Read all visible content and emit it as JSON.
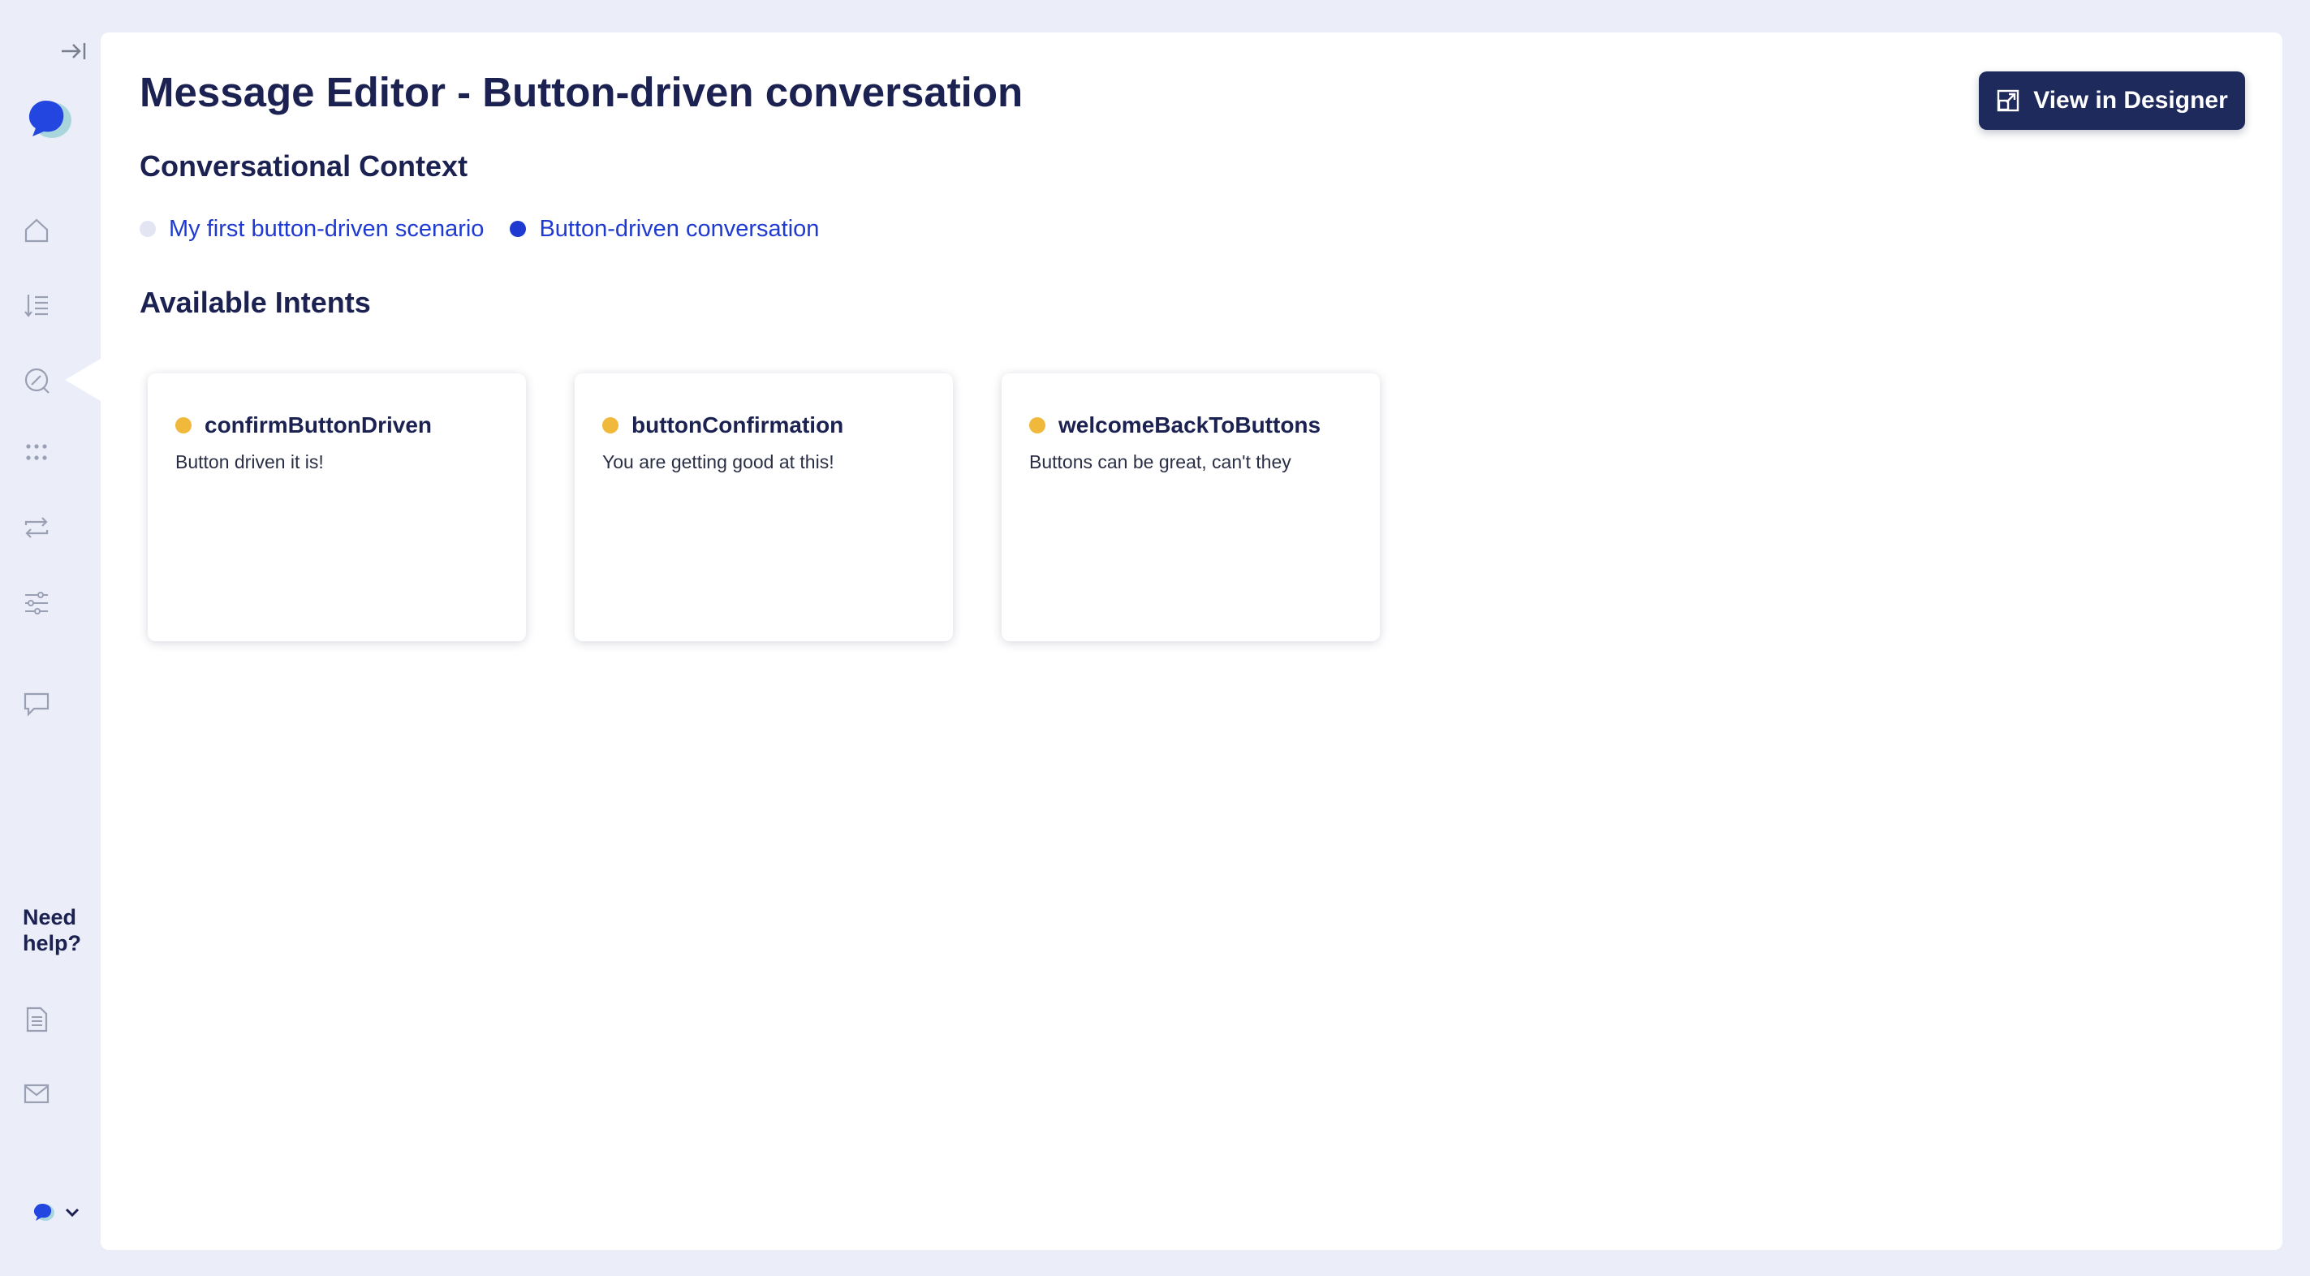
{
  "sidebar": {
    "collapse_icon": "collapse-right-icon",
    "nav_items": [
      {
        "name": "home-icon"
      },
      {
        "name": "sort-list-icon"
      },
      {
        "name": "message-editor-icon",
        "active": true
      },
      {
        "name": "grid-dots-icon"
      },
      {
        "name": "repeat-icon"
      },
      {
        "name": "sliders-icon"
      },
      {
        "name": "chat-icon"
      }
    ],
    "help_label": "Need help?",
    "help_items": [
      {
        "name": "document-icon"
      },
      {
        "name": "mail-icon"
      }
    ]
  },
  "header": {
    "title": "Message Editor - Button-driven conversation",
    "view_button_label": "View in Designer",
    "view_button_icon": "open-external-icon"
  },
  "context": {
    "heading": "Conversational Context",
    "items": [
      {
        "label": "My first button-driven scenario",
        "dot_color": "#e3e6f2"
      },
      {
        "label": "Button-driven conversation",
        "dot_color": "#1f3ad0"
      }
    ]
  },
  "intents": {
    "heading": "Available Intents",
    "items": [
      {
        "name": "confirmButtonDriven",
        "text": "Button driven it is!",
        "dot_color": "#f0b93b"
      },
      {
        "name": "buttonConfirmation",
        "text": "You are getting good at this!",
        "dot_color": "#f0b93b"
      },
      {
        "name": "welcomeBackToButtons",
        "text": "Buttons can be great, can't they",
        "dot_color": "#f0b93b"
      }
    ]
  },
  "colors": {
    "background": "#ebeef8",
    "primary_dark": "#1d2a5b",
    "link_blue": "#1f3ad0",
    "intent_dot": "#f0b93b"
  }
}
